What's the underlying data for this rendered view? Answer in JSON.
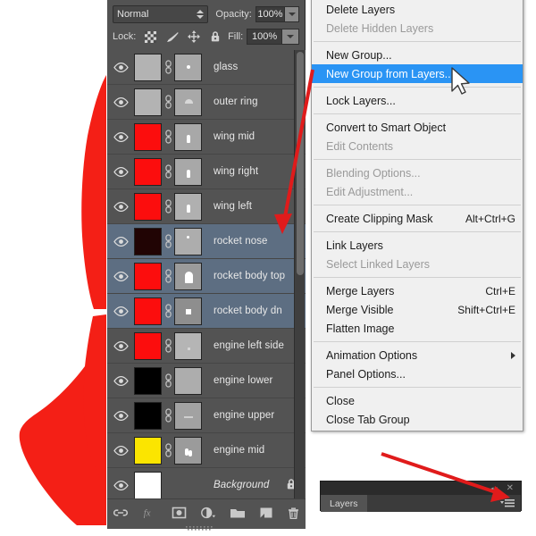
{
  "app": "Adobe Photoshop Layers Panel",
  "panel": {
    "blend_mode": "Normal",
    "opacity_label": "Opacity:",
    "opacity_value": "100%",
    "lock_label": "Lock:",
    "fill_label": "Fill:",
    "fill_value": "100%",
    "lock_icons": [
      {
        "name": "lock-transparent-pixels-icon",
        "glyph": "checker"
      },
      {
        "name": "lock-image-pixels-icon",
        "glyph": "brush"
      },
      {
        "name": "lock-position-icon",
        "glyph": "move"
      },
      {
        "name": "lock-all-icon",
        "glyph": "lock"
      }
    ],
    "footer_icons": [
      {
        "name": "link-layers-icon",
        "glyph": "link"
      },
      {
        "name": "layer-style-fx-icon",
        "glyph": "fx"
      },
      {
        "name": "add-layer-mask-icon",
        "glyph": "mask"
      },
      {
        "name": "new-fill-adjustment-layer-icon",
        "glyph": "halfcircle"
      },
      {
        "name": "new-group-icon",
        "glyph": "folder"
      },
      {
        "name": "new-layer-icon",
        "glyph": "newlayer"
      },
      {
        "name": "delete-layer-icon",
        "glyph": "trash"
      }
    ],
    "layers": [
      {
        "name": "glass",
        "thumb": "#b3b3b3",
        "mask": "#a8a8a8",
        "mask_shape": "dot",
        "selected": false,
        "linked": true,
        "locked": false
      },
      {
        "name": "outer ring",
        "thumb": "#b3b3b3",
        "mask": "#a8a8a8",
        "mask_shape": "arc",
        "selected": false,
        "linked": true,
        "locked": false
      },
      {
        "name": "wing mid",
        "thumb": "#fc0d0d",
        "mask": "#a8a8a8",
        "mask_shape": "wing",
        "selected": false,
        "linked": true,
        "locked": false
      },
      {
        "name": "wing right",
        "thumb": "#fc0d0d",
        "mask": "#a8a8a8",
        "mask_shape": "wing",
        "selected": false,
        "linked": true,
        "locked": false
      },
      {
        "name": "wing left",
        "thumb": "#fc0d0d",
        "mask": "#b0b0b0",
        "mask_shape": "wing",
        "selected": false,
        "linked": true,
        "locked": false
      },
      {
        "name": "rocket nose",
        "thumb": "#210404",
        "mask": "#adadad",
        "mask_shape": "dotsm",
        "selected": true,
        "linked": true,
        "locked": false
      },
      {
        "name": "rocket body top",
        "thumb": "#fc0d0d",
        "mask": "#9b9b9b",
        "mask_shape": "nose",
        "selected": true,
        "linked": true,
        "locked": false
      },
      {
        "name": "rocket body dn",
        "thumb": "#fc0d0d",
        "mask": "#8e8e8e",
        "mask_shape": "square",
        "selected": true,
        "linked": true,
        "locked": false
      },
      {
        "name": "engine left side",
        "thumb": "#fc0d0d",
        "mask": "#b5b5b5",
        "mask_shape": "faint",
        "selected": false,
        "linked": true,
        "locked": false
      },
      {
        "name": "engine lower",
        "thumb": "#000000",
        "mask": "#adadad",
        "mask_shape": "none",
        "selected": false,
        "linked": true,
        "locked": false
      },
      {
        "name": "engine upper",
        "thumb": "#000000",
        "mask": "#a2a2a2",
        "mask_shape": "bar",
        "selected": false,
        "linked": true,
        "locked": false
      },
      {
        "name": "engine mid",
        "thumb": "#fbe500",
        "mask": "#9b9b9b",
        "mask_shape": "flame",
        "selected": false,
        "linked": true,
        "locked": false
      },
      {
        "name": "Background",
        "thumb": "#ffffff",
        "mask": null,
        "mask_shape": "none",
        "selected": false,
        "linked": false,
        "locked": true
      }
    ]
  },
  "context_menu": {
    "items": [
      {
        "label": "Delete Layers",
        "shortcut": "",
        "disabled": false,
        "highlighted": false,
        "submenu": false
      },
      {
        "label": "Delete Hidden Layers",
        "shortcut": "",
        "disabled": true,
        "highlighted": false,
        "submenu": false
      },
      {
        "sep": true
      },
      {
        "label": "New Group...",
        "shortcut": "",
        "disabled": false,
        "highlighted": false,
        "submenu": false
      },
      {
        "label": "New Group from Layers...",
        "shortcut": "",
        "disabled": false,
        "highlighted": true,
        "submenu": false
      },
      {
        "sep": true
      },
      {
        "label": "Lock Layers...",
        "shortcut": "",
        "disabled": false,
        "highlighted": false,
        "submenu": false
      },
      {
        "sep": true
      },
      {
        "label": "Convert to Smart Object",
        "shortcut": "",
        "disabled": false,
        "highlighted": false,
        "submenu": false
      },
      {
        "label": "Edit Contents",
        "shortcut": "",
        "disabled": true,
        "highlighted": false,
        "submenu": false
      },
      {
        "sep": true
      },
      {
        "label": "Blending Options...",
        "shortcut": "",
        "disabled": true,
        "highlighted": false,
        "submenu": false
      },
      {
        "label": "Edit Adjustment...",
        "shortcut": "",
        "disabled": true,
        "highlighted": false,
        "submenu": false
      },
      {
        "sep": true
      },
      {
        "label": "Create Clipping Mask",
        "shortcut": "Alt+Ctrl+G",
        "disabled": false,
        "highlighted": false,
        "submenu": false
      },
      {
        "sep": true
      },
      {
        "label": "Link Layers",
        "shortcut": "",
        "disabled": false,
        "highlighted": false,
        "submenu": false
      },
      {
        "label": "Select Linked Layers",
        "shortcut": "",
        "disabled": true,
        "highlighted": false,
        "submenu": false
      },
      {
        "sep": true
      },
      {
        "label": "Merge Layers",
        "shortcut": "Ctrl+E",
        "disabled": false,
        "highlighted": false,
        "submenu": false
      },
      {
        "label": "Merge Visible",
        "shortcut": "Shift+Ctrl+E",
        "disabled": false,
        "highlighted": false,
        "submenu": false
      },
      {
        "label": "Flatten Image",
        "shortcut": "",
        "disabled": false,
        "highlighted": false,
        "submenu": false
      },
      {
        "sep": true
      },
      {
        "label": "Animation Options",
        "shortcut": "",
        "disabled": false,
        "highlighted": false,
        "submenu": true
      },
      {
        "label": "Panel Options...",
        "shortcut": "",
        "disabled": false,
        "highlighted": false,
        "submenu": false
      },
      {
        "sep": true
      },
      {
        "label": "Close",
        "shortcut": "",
        "disabled": false,
        "highlighted": false,
        "submenu": false
      },
      {
        "label": "Close Tab Group",
        "shortcut": "",
        "disabled": false,
        "highlighted": false,
        "submenu": false
      }
    ]
  },
  "mini_panel": {
    "tab_label": "Layers",
    "collapse_icon": "double-chevron-left-icon",
    "close_icon": "close-icon",
    "menu_icon": "panel-menu-icon"
  },
  "annotations": {
    "arrow_top": "arrow from New Group from Layers menu item to rocket nose layer row",
    "arrow_bottom": "arrow pointing to panel menu button",
    "cursor": "mouse-pointer"
  },
  "colors": {
    "accent_highlight": "#2a94f4",
    "selection_row": "#5d6e82",
    "panel_bg": "#535353",
    "menu_bg": "#f0f0f0",
    "annotation_red": "#e01b1b",
    "artwork_red": "#f41f16"
  }
}
